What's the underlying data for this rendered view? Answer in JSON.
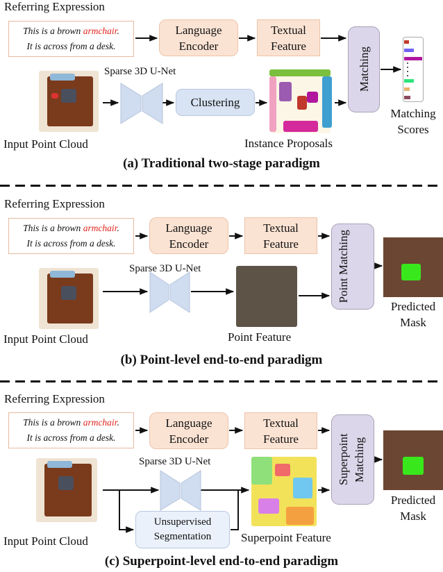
{
  "panels": [
    {
      "id": "a",
      "referring_label": "Referring Expression",
      "sentence": {
        "line1_prefix": "This is a brown ",
        "line1_highlight": "armchair",
        "line1_suffix": ".",
        "line2": "It is across from a desk."
      },
      "language_encoder": "Language Encoder",
      "textual_feature": "Textual Feature",
      "backbone_label": "Sparse 3D U-Net",
      "input_label": "Input Point Cloud",
      "clustering": "Clustering",
      "proposals_label": "Instance Proposals",
      "matching": "Matching",
      "output_label": "Matching Scores",
      "caption": "(a) Traditional two-stage paradigm"
    },
    {
      "id": "b",
      "referring_label": "Referring Expression",
      "sentence": {
        "line1_prefix": "This is a brown ",
        "line1_highlight": "armchair",
        "line1_suffix": ".",
        "line2": "It is across from a desk."
      },
      "language_encoder": "Language Encoder",
      "textual_feature": "Textual Feature",
      "backbone_label": "Sparse 3D U-Net",
      "input_label": "Input Point Cloud",
      "feature_label": "Point Feature",
      "matching": "Point Matching",
      "output_label": "Predicted Mask",
      "caption": "(b) Point-level end-to-end paradigm"
    },
    {
      "id": "c",
      "referring_label": "Referring Expression",
      "sentence": {
        "line1_prefix": "This is a brown ",
        "line1_highlight": "armchair",
        "line1_suffix": ".",
        "line2": "It is across from a desk."
      },
      "language_encoder": "Language Encoder",
      "textual_feature": "Textual Feature",
      "backbone_label": "Sparse 3D U-Net",
      "input_label": "Input Point Cloud",
      "unsupervised": "Unsupervised Segmentation",
      "feature_label": "Superpoint Feature",
      "matching": "Superpoint Matching",
      "output_label": "Predicted Mask",
      "caption": "(c) Superpoint-level end-to-end paradigm"
    }
  ],
  "matching_scores_bars": [
    {
      "color": "#c0392b",
      "value": 0.25
    },
    {
      "color": "#6f63f2",
      "value": 0.55
    },
    {
      "color": "#b0169e",
      "value": 1.0
    },
    {
      "color": "#2ee57a",
      "value": 0.55
    },
    {
      "color": "#e6b36a",
      "value": 0.3
    },
    {
      "color": "#8e4a5c",
      "value": 0.35
    }
  ],
  "colors": {
    "highlight": "#e0221b",
    "encoder_fill": "#fbe3d3",
    "cluster_fill": "#d8e3f3",
    "matching_fill": "#dcd6ea",
    "unet_fill": "#d0dcef",
    "mask_green": "#39e81c"
  }
}
